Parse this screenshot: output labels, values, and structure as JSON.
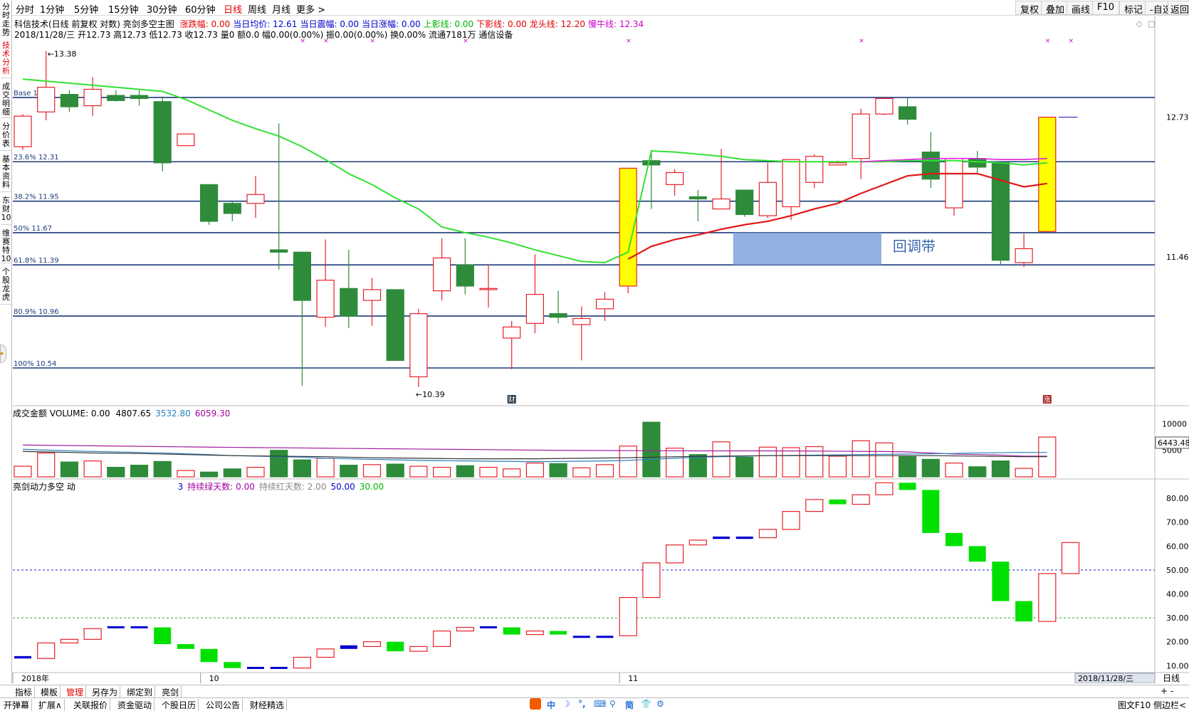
{
  "sidebar": {
    "tabs": [
      "分时走势",
      "技术分析",
      "成交明细",
      "分价表",
      "基本资料",
      "东财10",
      "维赛特10",
      "个股龙虎"
    ]
  },
  "toolbar": {
    "periods": [
      "分时",
      "1分钟",
      "5分钟",
      "15分钟",
      "30分钟",
      "60分钟",
      "日线",
      "周线",
      "月线",
      "更多 >"
    ],
    "active_period": "日线",
    "right_buttons": [
      "复权",
      "叠加",
      "画线",
      "F10",
      "标记",
      "-自选",
      "返回"
    ]
  },
  "info": {
    "stock_title": "科信技术(日线 前复权 对数) 亮剑多空主图",
    "items": [
      {
        "label": "涨跌幅: 0.00",
        "color": "#e00000"
      },
      {
        "label": "当日均价: 12.61",
        "color": "#0000cc"
      },
      {
        "label": "当日震幅: 0.00",
        "color": "#0000cc"
      },
      {
        "label": "当日涨幅: 0.00",
        "color": "#0000cc"
      },
      {
        "label": "上影线: 0.00",
        "color": "#00b000"
      },
      {
        "label": "下影线: 0.00",
        "color": "#e00000"
      },
      {
        "label": "龙头线: 12.20",
        "color": "#e00000"
      },
      {
        "label": "慢牛线: 12.34",
        "color": "#cc00cc"
      }
    ],
    "day_line": "2018/11/28/三 开12.73 高12.73 低12.73 收12.73 量0 额0.0 幅0.00(0.00%) 振0.00(0.00%) 换0.00% 流通7181万 通信设备"
  },
  "chart_data": [
    {
      "type": "candlestick",
      "name": "main",
      "fib_levels": [
        {
          "label": "Base 12.92",
          "value": 12.92
        },
        {
          "label": "23.6% 12.31",
          "value": 12.31
        },
        {
          "label": "38.2% 11.95",
          "value": 11.95
        },
        {
          "label": "50% 11.67",
          "value": 11.67
        },
        {
          "label": "61.8% 11.39",
          "value": 11.39
        },
        {
          "label": "80.9% 10.96",
          "value": 10.96
        },
        {
          "label": "100% 10.54",
          "value": 10.54
        }
      ],
      "high_marker": "13.38",
      "low_marker": "10.39",
      "right_ticks": [
        "12.73",
        "11.46"
      ],
      "annotation": "回调带",
      "event_badges": [
        "财",
        "涨"
      ],
      "ylim": [
        10.3,
        13.5
      ],
      "candles": [
        {
          "o": 12.45,
          "c": 12.74,
          "h": 12.76,
          "l": 12.42
        },
        {
          "o": 12.78,
          "c": 13.02,
          "h": 13.38,
          "l": 12.7
        },
        {
          "o": 12.95,
          "c": 12.83,
          "h": 12.99,
          "l": 12.78
        },
        {
          "o": 12.84,
          "c": 13.0,
          "h": 13.12,
          "l": 12.74
        },
        {
          "o": 12.94,
          "c": 12.89,
          "h": 12.99,
          "l": 12.88
        },
        {
          "o": 12.94,
          "c": 12.91,
          "h": 12.99,
          "l": 12.84
        },
        {
          "o": 12.88,
          "c": 12.3,
          "h": 12.93,
          "l": 12.22
        },
        {
          "o": 12.46,
          "c": 12.57,
          "h": 12.57,
          "l": 12.46
        },
        {
          "o": 12.1,
          "c": 11.77,
          "h": 12.1,
          "l": 11.74
        },
        {
          "o": 11.93,
          "c": 11.84,
          "h": 11.95,
          "l": 11.77
        },
        {
          "o": 11.93,
          "c": 12.01,
          "h": 12.18,
          "l": 11.8
        },
        {
          "o": 11.52,
          "c": 11.5,
          "h": 12.67,
          "l": 11.35
        },
        {
          "o": 11.5,
          "c": 11.09,
          "h": 11.5,
          "l": 10.4
        },
        {
          "o": 10.95,
          "c": 11.26,
          "h": 11.61,
          "l": 10.87
        },
        {
          "o": 11.19,
          "c": 10.96,
          "h": 11.52,
          "l": 10.86
        },
        {
          "o": 11.09,
          "c": 11.18,
          "h": 11.28,
          "l": 10.88
        },
        {
          "o": 11.18,
          "c": 10.6,
          "h": 11.18,
          "l": 10.6
        },
        {
          "o": 10.47,
          "c": 10.98,
          "h": 11.02,
          "l": 10.39
        },
        {
          "o": 11.17,
          "c": 11.45,
          "h": 11.62,
          "l": 11.09
        },
        {
          "o": 11.39,
          "c": 11.21,
          "h": 11.62,
          "l": 11.14
        },
        {
          "o": 11.18,
          "c": 11.19,
          "h": 11.39,
          "l": 11.03
        },
        {
          "o": 10.78,
          "c": 10.87,
          "h": 10.92,
          "l": 10.53
        },
        {
          "o": 10.9,
          "c": 11.14,
          "h": 11.48,
          "l": 10.82
        },
        {
          "o": 10.98,
          "c": 10.95,
          "h": 11.17,
          "l": 10.9
        },
        {
          "o": 10.89,
          "c": 10.94,
          "h": 11.04,
          "l": 10.6
        },
        {
          "o": 11.02,
          "c": 11.1,
          "h": 11.16,
          "l": 10.92
        },
        {
          "o": 11.21,
          "c": 12.25,
          "h": 12.25,
          "l": 11.15
        },
        {
          "o": 12.32,
          "c": 12.28,
          "h": 12.42,
          "l": 11.88
        },
        {
          "o": 12.1,
          "c": 12.21,
          "h": 12.24,
          "l": 12.0
        },
        {
          "o": 11.99,
          "c": 11.97,
          "h": 12.05,
          "l": 11.77
        },
        {
          "o": 11.88,
          "c": 11.97,
          "h": 12.43,
          "l": 11.88
        },
        {
          "o": 12.05,
          "c": 11.83,
          "h": 12.05,
          "l": 11.81
        },
        {
          "o": 11.82,
          "c": 12.12,
          "h": 12.3,
          "l": 11.8
        },
        {
          "o": 11.9,
          "c": 12.33,
          "h": 12.33,
          "l": 11.78
        },
        {
          "o": 12.12,
          "c": 12.36,
          "h": 12.38,
          "l": 12.07
        },
        {
          "o": 12.28,
          "c": 12.3,
          "h": 12.32,
          "l": 12.28
        },
        {
          "o": 12.34,
          "c": 12.76,
          "h": 12.81,
          "l": 12.15
        },
        {
          "o": 12.76,
          "c": 12.91,
          "h": 12.92,
          "l": 12.75
        },
        {
          "o": 12.83,
          "c": 12.71,
          "h": 12.92,
          "l": 12.66
        },
        {
          "o": 12.4,
          "c": 12.15,
          "h": 12.59,
          "l": 12.07
        },
        {
          "o": 11.89,
          "c": 12.34,
          "h": 12.34,
          "l": 11.82
        },
        {
          "o": 12.34,
          "c": 12.26,
          "h": 12.41,
          "l": 12.2
        },
        {
          "o": 12.3,
          "c": 11.43,
          "h": 12.3,
          "l": 11.39
        },
        {
          "o": 11.41,
          "c": 11.53,
          "h": 11.66,
          "l": 11.37
        },
        {
          "o": 11.68,
          "c": 12.73,
          "h": 12.73,
          "l": 11.67
        }
      ],
      "highlight_indices": [
        26,
        44
      ],
      "ma_green": [
        13.1,
        13.08,
        13.06,
        13.04,
        13.02,
        13.0,
        12.98,
        12.9,
        12.8,
        12.7,
        12.62,
        12.55,
        12.45,
        12.33,
        12.2,
        12.1,
        11.98,
        11.88,
        11.72,
        11.67,
        11.63,
        11.58,
        11.52,
        11.47,
        11.42,
        11.41,
        11.5,
        12.41,
        12.4,
        12.38,
        12.36,
        12.33,
        12.32,
        12.31,
        12.31,
        12.31,
        12.31,
        12.31,
        12.32,
        12.32,
        12.32,
        12.31,
        12.3,
        12.28,
        12.3
      ],
      "ma_red": [
        null,
        null,
        null,
        null,
        null,
        null,
        null,
        null,
        null,
        null,
        null,
        null,
        null,
        null,
        null,
        null,
        null,
        null,
        null,
        null,
        null,
        null,
        null,
        null,
        null,
        null,
        11.44,
        11.55,
        11.61,
        11.65,
        11.7,
        11.74,
        11.77,
        11.82,
        11.88,
        11.93,
        12.02,
        12.1,
        12.18,
        12.2,
        12.2,
        12.2,
        12.14,
        12.08,
        12.11
      ],
      "ma_purple": [
        null,
        null,
        null,
        null,
        null,
        null,
        null,
        null,
        null,
        null,
        null,
        null,
        null,
        null,
        null,
        null,
        null,
        null,
        null,
        null,
        null,
        null,
        null,
        null,
        null,
        null,
        null,
        null,
        null,
        null,
        null,
        null,
        null,
        null,
        null,
        null,
        12.31,
        12.32,
        12.33,
        12.34,
        12.34,
        12.34,
        12.33,
        12.33,
        12.34
      ]
    },
    {
      "type": "bar",
      "name": "volume",
      "title": "成交金额 VOLUME: 0.00",
      "stats": [
        {
          "text": "4807.65",
          "color": "#000000"
        },
        {
          "text": "3532.80",
          "color": "#2a7fbf"
        },
        {
          "text": "6059.30",
          "color": "#a000a0"
        }
      ],
      "right_ticks": [
        "10000",
        "5000"
      ],
      "current_value": "6443.48",
      "ylim": [
        0,
        11000
      ],
      "values": [
        2000,
        4500,
        2800,
        3000,
        1800,
        2200,
        2900,
        1200,
        900,
        1500,
        1800,
        5000,
        3200,
        3500,
        2200,
        2300,
        2400,
        2000,
        1800,
        2100,
        1800,
        1500,
        2600,
        2500,
        1700,
        2300,
        5800,
        10300,
        5400,
        4200,
        6600,
        3700,
        5600,
        5500,
        5700,
        3900,
        6800,
        6400,
        3800,
        3300,
        2600,
        1900,
        3000,
        1600,
        7500
      ],
      "line1": [
        6000,
        5950,
        5900,
        5850,
        5800,
        5750,
        5700,
        5650,
        5600,
        5560,
        5520,
        5480,
        5440,
        5400,
        5360,
        5320,
        5280,
        5240,
        5200,
        5160,
        5120,
        5080,
        5040,
        5000,
        4980,
        4960,
        4940,
        4920,
        4910,
        4900,
        4900,
        4900,
        4900,
        4880,
        4860,
        4840,
        4800,
        4780,
        4700,
        4500,
        4300,
        4200,
        4100,
        3900,
        3900
      ],
      "line2": [
        5200,
        5050,
        4900,
        4800,
        4700,
        4600,
        4500,
        4350,
        4200,
        4000,
        3900,
        3800,
        3700,
        3500,
        3400,
        3300,
        3200,
        3100,
        3050,
        3000,
        2950,
        2900,
        2850,
        2900,
        2950,
        3000,
        3100,
        3300,
        3500,
        3700,
        3800,
        3900,
        4000,
        4050,
        4100,
        4150,
        4200,
        4250,
        4300,
        4350,
        4400,
        4500,
        4550,
        4600,
        4600
      ],
      "line3": [
        4800,
        4700,
        4600,
        4500,
        4450,
        4400,
        4300,
        4200,
        4100,
        4000,
        3950,
        3900,
        3850,
        3800,
        3700,
        3600,
        3550,
        3500,
        3450,
        3400,
        3400,
        3400,
        3400,
        3450,
        3500,
        3550,
        3600,
        3700,
        3800,
        3850,
        3900,
        3950,
        4000,
        4000,
        4000,
        4000,
        4000,
        4000,
        4000,
        4000,
        3950,
        3900,
        3850,
        3800,
        3800
      ]
    },
    {
      "type": "bar",
      "name": "indicator",
      "title": "亮剑动力多空 动",
      "stats": [
        {
          "text": "3",
          "color": "#0000cc"
        },
        {
          "text": "持续绿天数: 0.00",
          "color": "#a000a0"
        },
        {
          "text": "持续红天数: 2.00",
          "color": "#888888"
        },
        {
          "text": "50.00",
          "color": "#0000cc"
        },
        {
          "text": "30.00",
          "color": "#00b000"
        }
      ],
      "right_ticks": [
        "80.00",
        "70.00",
        "60.00",
        "50.00",
        "40.00",
        "30.00",
        "20.00",
        "10.00"
      ],
      "ylim": [
        8,
        86
      ],
      "ref_lines": [
        50,
        30
      ],
      "blocks": [
        {
          "o": 13,
          "c": 14,
          "k": "b"
        },
        {
          "o": 13,
          "c": 19.5,
          "k": "r"
        },
        {
          "o": 19.5,
          "c": 21,
          "k": "r"
        },
        {
          "o": 21,
          "c": 25.5,
          "k": "r"
        },
        {
          "o": 26,
          "c": 26.5,
          "k": "b"
        },
        {
          "o": 26,
          "c": 26.5,
          "k": "b"
        },
        {
          "o": 26,
          "c": 19,
          "k": "g"
        },
        {
          "o": 19,
          "c": 17,
          "k": "g"
        },
        {
          "o": 17,
          "c": 11.5,
          "k": "g"
        },
        {
          "o": 11.5,
          "c": 9,
          "k": "g"
        },
        {
          "o": 9,
          "c": 9.5,
          "k": "b"
        },
        {
          "o": 9,
          "c": 9.5,
          "k": "b"
        },
        {
          "o": 9,
          "c": 13.5,
          "k": "r"
        },
        {
          "o": 13.5,
          "c": 17,
          "k": "r"
        },
        {
          "o": 17,
          "c": 18.5,
          "k": "b"
        },
        {
          "o": 18,
          "c": 20,
          "k": "r"
        },
        {
          "o": 20,
          "c": 16,
          "k": "g"
        },
        {
          "o": 16,
          "c": 18,
          "k": "r"
        },
        {
          "o": 18,
          "c": 24.5,
          "k": "r"
        },
        {
          "o": 24.5,
          "c": 26,
          "k": "r"
        },
        {
          "o": 26,
          "c": 26.5,
          "k": "b"
        },
        {
          "o": 26,
          "c": 23,
          "k": "g"
        },
        {
          "o": 23,
          "c": 24.5,
          "k": "r"
        },
        {
          "o": 24.5,
          "c": 23,
          "k": "g"
        },
        {
          "o": 22,
          "c": 22.5,
          "k": "b"
        },
        {
          "o": 22,
          "c": 22.5,
          "k": "b"
        },
        {
          "o": 22.5,
          "c": 38.5,
          "k": "r"
        },
        {
          "o": 38.5,
          "c": 53,
          "k": "r"
        },
        {
          "o": 53,
          "c": 60.5,
          "k": "r"
        },
        {
          "o": 60.5,
          "c": 62.5,
          "k": "r"
        },
        {
          "o": 63,
          "c": 64,
          "k": "b"
        },
        {
          "o": 63,
          "c": 64,
          "k": "b"
        },
        {
          "o": 63.5,
          "c": 67,
          "k": "r"
        },
        {
          "o": 67,
          "c": 74.5,
          "k": "r"
        },
        {
          "o": 74.5,
          "c": 79.5,
          "k": "r"
        },
        {
          "o": 79.5,
          "c": 77.5,
          "k": "g"
        },
        {
          "o": 77.5,
          "c": 81.5,
          "k": "r"
        },
        {
          "o": 81.5,
          "c": 86.5,
          "k": "r"
        },
        {
          "o": 86.5,
          "c": 83.5,
          "k": "g"
        },
        {
          "o": 83.5,
          "c": 65.5,
          "k": "g"
        },
        {
          "o": 65.5,
          "c": 60,
          "k": "g"
        },
        {
          "o": 60,
          "c": 53.5,
          "k": "g"
        },
        {
          "o": 53.5,
          "c": 37,
          "k": "g"
        },
        {
          "o": 37,
          "c": 28.5,
          "k": "g"
        },
        {
          "o": 28.5,
          "c": 48.5,
          "k": "r"
        },
        {
          "o": 48.5,
          "c": 61.5,
          "k": "r"
        }
      ]
    }
  ],
  "xaxis": {
    "labels": [
      {
        "text": "2018年",
        "index": 0
      },
      {
        "text": "10",
        "index": 8
      },
      {
        "text": "11",
        "index": 26
      }
    ],
    "current_date": "2018/11/28/三",
    "period_label": "日线"
  },
  "bottom_row1": [
    "指标",
    "模板",
    "管理",
    "另存为",
    "绑定到",
    "亮剑"
  ],
  "bottom_row1_active": "管理",
  "bottom_row2": [
    "开弹幕",
    "扩展∧",
    "关联报价",
    "资金驱动",
    "个股日历",
    "公司公告",
    "财经精选"
  ],
  "bottom_center_icons": [
    "中",
    "☽",
    "°,",
    "⌨",
    "⚲",
    "简",
    "👕",
    "⚙"
  ],
  "bottom_right": [
    "图文F10",
    "侧边栏<"
  ]
}
